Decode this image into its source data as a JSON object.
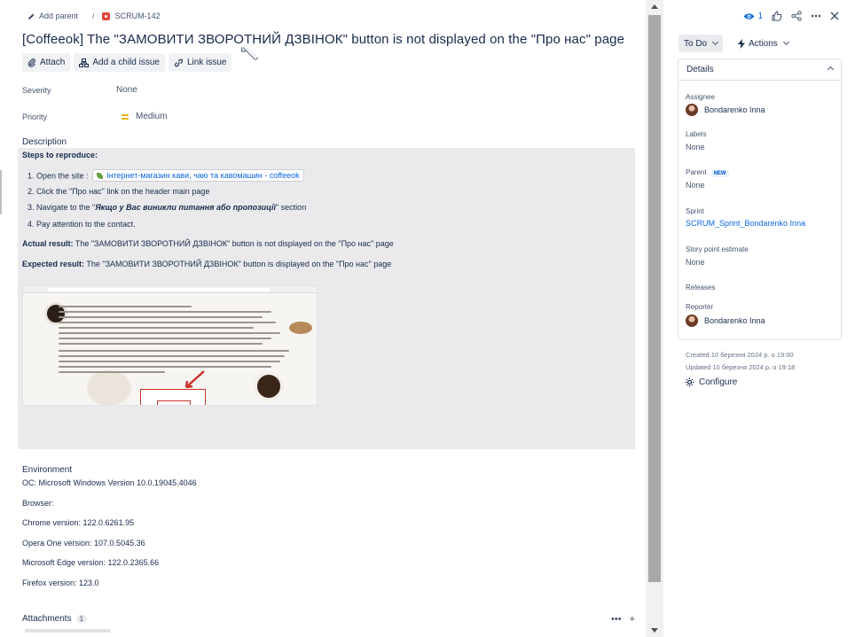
{
  "breadcrumb": {
    "add_parent": "Add parent",
    "issue_key": "SCRUM-142"
  },
  "issue": {
    "title": "[Coffeeok] The \"ЗАМОВИТИ ЗВОРОТНИЙ ДЗВІНОК\" button is not displayed on the \"Про нас\" page"
  },
  "toolbar": {
    "attach": "Attach",
    "add_child": "Add a child issue",
    "link_issue": "Link issue"
  },
  "fields": {
    "severity_label": "Severity",
    "severity_value": "None",
    "priority_label": "Priority",
    "priority_value": "Medium",
    "priority_color": "#e2b203"
  },
  "description": {
    "label": "Description",
    "steps_heading": "Steps to reproduce:",
    "step1_prefix": "1. Open the  site :",
    "step1_link": "Інтернет-магазин кави, чаю та кавомашин - coffeeok",
    "step2": "2. Click the \"Про нас\" link on the header main page",
    "step3_prefix": "3. Navigate to the \"",
    "step3_bold": "Якщо у Вас виникли питання або пропозиції",
    "step3_suffix": "\" section",
    "step4": "4. Pay attention to the contact.",
    "actual_label": "Actual result:",
    "actual_text": " The \"ЗАМОВИТИ ЗВОРОТНИЙ ДЗВІНОК\" button is not displayed on the \"Про нас\" page",
    "expected_label": "Expected result:",
    "expected_text": "  The \"ЗАМОВИТИ ЗВОРОТНИЙ ДЗВІНОК\" button is displayed on the \"Про нас\" page"
  },
  "environment": {
    "label": "Environment",
    "os": "ОС: Microsoft Windows Version 10.0.19045.4046",
    "browser": "Browser:",
    "chrome": "Chrome version: 122.0.6261.95",
    "opera": "Opera One version: 107.0.5045.36",
    "edge": "Microsoft Edge version: 122.0.2365.66",
    "firefox": "Firefox version: 123.0"
  },
  "attachments": {
    "label": "Attachments",
    "count": "1"
  },
  "side": {
    "watch_count": "1",
    "status": "To Do",
    "actions": "Actions",
    "details_title": "Details",
    "assignee_label": "Assignee",
    "assignee": "Bondarenko Inna",
    "labels_label": "Labels",
    "labels_value": "None",
    "parent_label": "Parent",
    "parent_badge": "NEW",
    "parent_value": "None",
    "sprint_label": "Sprint",
    "sprint_value": "SCRUM_Sprint_Bondarenko Inna",
    "story_label": "Story point estimate",
    "story_value": "None",
    "releases_label": "Releases",
    "reporter_label": "Reporter",
    "reporter": "Bondarenko Inna",
    "created": "Created 10 березня 2024 р. о 19:00",
    "updated": "Updated 10 березня 2024 р. о 19:18",
    "configure": "Configure"
  }
}
